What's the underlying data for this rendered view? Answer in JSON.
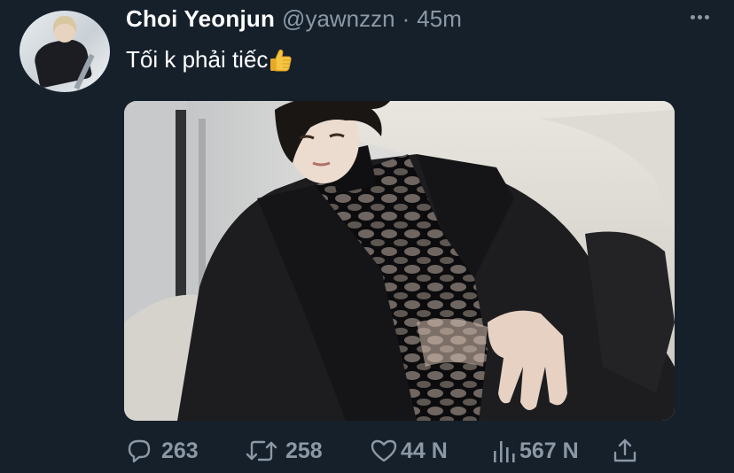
{
  "tweet": {
    "author": {
      "display_name": "Choi Yeonjun",
      "handle": "@yawnzzn",
      "separator": "·",
      "time": "45m"
    },
    "text": "Tối k phải tiếc",
    "emoji": "thumbs-up",
    "actions": {
      "replies": "263",
      "retweets": "258",
      "likes": "44 N",
      "views": "567 N"
    }
  },
  "icons": {
    "more": "more-horizontal-icon",
    "reply": "reply-icon",
    "retweet": "retweet-icon",
    "like": "heart-icon",
    "views": "views-chart-icon",
    "share": "share-icon"
  },
  "colors": {
    "background": "#15202b",
    "text_primary": "#ffffff",
    "text_secondary": "#8b98a5"
  }
}
